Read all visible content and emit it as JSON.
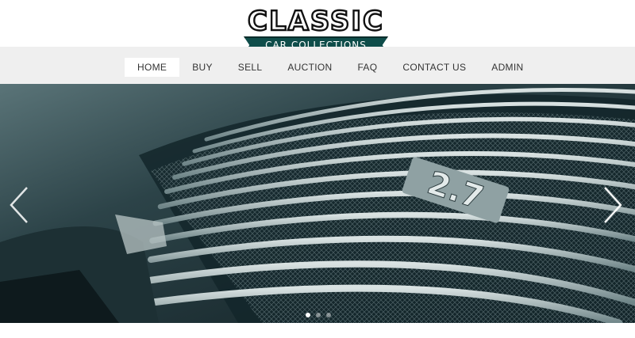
{
  "brand": {
    "logo_word": "CLASSIC",
    "logo_banner": "CAR COLLECTIONS",
    "colors": {
      "banner": "#0f4d4a",
      "outline": "#111111"
    }
  },
  "nav": {
    "items": [
      {
        "label": "HOME",
        "active": true
      },
      {
        "label": "BUY",
        "active": false
      },
      {
        "label": "SELL",
        "active": false
      },
      {
        "label": "AUCTION",
        "active": false
      },
      {
        "label": "FAQ",
        "active": false
      },
      {
        "label": "CONTACT US",
        "active": false
      },
      {
        "label": "ADMIN",
        "active": false
      }
    ]
  },
  "hero": {
    "image": "classic-car-grille-photo",
    "badge_text": "2.7",
    "slide_count": 3,
    "current_slide": 1,
    "prev_icon": "chevron-left-icon",
    "next_icon": "chevron-right-icon"
  }
}
